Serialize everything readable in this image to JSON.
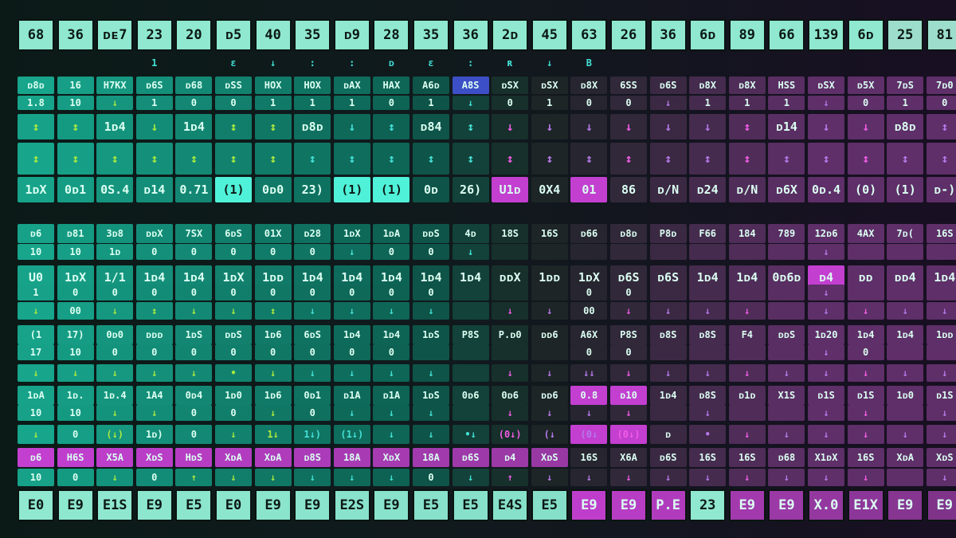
{
  "colors": {
    "light": "#8fe8cf",
    "teal": "#17a58c",
    "teal_dark": "#0c5a4d",
    "dark": "#1a2422",
    "magenta": "#c33fd0",
    "purple": "#5e2f68",
    "blue": "#3d4fc6",
    "text_dark": "#0c1814",
    "text_light": "#dcfff2",
    "arrow_green": "#a9ea3f",
    "arrow_cyan": "#44e1d6",
    "arrow_pink": "#f25ce6",
    "arrow_purple": "#b67aea"
  },
  "header_row": [
    "68",
    "36",
    "ᴅᴇ7",
    "23",
    "20",
    "ᴅ5",
    "40",
    "35",
    "ᴅ9",
    "28",
    "35",
    "36",
    "2ᴅ",
    "45",
    "63",
    "26",
    "36",
    "6ᴅ",
    "89",
    "66",
    "139",
    "6ᴅ",
    "25",
    "81"
  ],
  "footer_row": [
    "E0",
    "E9",
    "E1S",
    "E9",
    "E5",
    "E0",
    "E9",
    "E9",
    "E2S",
    "E9",
    "E5",
    "E5",
    "E4S",
    "E5",
    "E9",
    "E9",
    "P.E",
    "23",
    "E9",
    "E9",
    "X.0",
    "E1X",
    "E9",
    "E9"
  ],
  "sparse_header_marks": [
    "1",
    "ɛ",
    "↓",
    ":",
    ":",
    "ᴅ",
    "ɛ",
    ":",
    "ʀ",
    "↓",
    "B"
  ],
  "grid_rows": [
    {
      "labels": [
        "ᴅ8ᴅ",
        "16",
        "H7KX",
        "ᴅ6S",
        "ᴅ68",
        "ᴅSS",
        "HOX",
        "HOX",
        "ᴅAX",
        "HAX",
        "A6ᴅ",
        "A8S",
        "ᴅSX",
        "ᴅSX",
        "ᴅ8X",
        "6SS",
        "ᴅ6S",
        "ᴅ8X",
        "ᴅ8X",
        "HSS",
        "ᴅSX",
        "ᴅ5X",
        "7ᴅS",
        "7ᴅ0"
      ]
    },
    {
      "labels": [
        "1.8",
        "10",
        "↓",
        "1",
        "0",
        "0",
        "1",
        "1",
        "1",
        "0",
        "1",
        "↓",
        "0",
        "1",
        "0",
        "0",
        "↓",
        "1",
        "1",
        "1",
        "↓",
        "0",
        "1",
        "0"
      ]
    },
    {
      "labels": [
        "↕",
        "↕",
        "1ᴅ4",
        "↓",
        "1ᴅ4",
        "↕",
        "↕",
        "ᴅ8ᴅ",
        "↓",
        "↕",
        "ᴅ84",
        "↕",
        "↓",
        "↓",
        "↓",
        "↓",
        "↓",
        "↓",
        "↕",
        "ᴅ14",
        "↓",
        "↓",
        "ᴅ8ᴅ",
        "↕"
      ]
    },
    {
      "labels": [
        "↕",
        "↕",
        "↕",
        "↕",
        "↕",
        "↕",
        "↕",
        "↕",
        "↕",
        "↕",
        "↕",
        "↕",
        "↕",
        "↕",
        "↕",
        "↕",
        "↕",
        "↕",
        "↕",
        "↕",
        "↕",
        "↕",
        "↕",
        "↕"
      ]
    },
    {
      "labels": [
        "1ᴅX",
        "0ᴅ1",
        "0S.4",
        "ᴅ14",
        "0.71",
        "(1)",
        "0ᴅ0",
        "23)",
        "(1)",
        "(1)",
        "0ᴅ",
        "26)",
        "U1ᴅ",
        "0X4",
        "01",
        "86",
        "ᴅ/N",
        "ᴅ24",
        "ᴅ/N",
        "ᴅ6X",
        "0ᴅ.4",
        "(0)",
        "(1)",
        "ᴅ-)"
      ]
    },
    {
      "labels": [
        "ᴅ6",
        "ᴅ81",
        "3ᴅ8",
        "ᴅᴅX",
        "7SX",
        "6ᴅS",
        "01X",
        "ᴅ28",
        "1ᴅX",
        "1ᴅA",
        "ᴅᴅS",
        "4ᴅ",
        "18S",
        "16S",
        "ᴅ66",
        "ᴅ8ᴅ",
        "P8ᴅ",
        "F66",
        "184",
        "789",
        "12ᴅ6",
        "4AX",
        "7ᴅ(",
        "16S"
      ]
    },
    {
      "labels": [
        "10",
        "10",
        "1ᴅ",
        "0",
        "0",
        "0",
        "0",
        "0",
        "↓",
        "0",
        "0",
        "↓",
        "",
        "",
        "",
        "",
        "",
        "",
        "",
        "",
        "↓",
        "",
        "",
        ""
      ]
    },
    {
      "labels": [
        "U0",
        "1ᴅX",
        "1/1",
        "1ᴅ4",
        "1ᴅ4",
        "1ᴅX",
        "1ᴅᴅ",
        "1ᴅ4",
        "1ᴅ4",
        "1ᴅ4",
        "1ᴅ4",
        "1ᴅ4",
        "ᴅᴅX",
        "1ᴅᴅ",
        "1ᴅX",
        "ᴅ6S",
        "ᴅ6S",
        "1ᴅ4",
        "1ᴅ4",
        "0ᴅ6ᴅ",
        "ᴅ4",
        "ᴅᴅ",
        "ᴅᴅ4",
        "1ᴅ4"
      ]
    },
    {
      "labels": [
        "1",
        "0",
        "0",
        "0",
        "0",
        "0",
        "0",
        "0",
        "0",
        "0",
        "0",
        "",
        "",
        "",
        "0",
        "0",
        "",
        "",
        "",
        "",
        "↓",
        "",
        "",
        ""
      ]
    },
    {
      "labels": [
        "↓",
        "00",
        "↓",
        "↕",
        "↓",
        "↓",
        "↕",
        "↓",
        "↓",
        "↓",
        "↓",
        "",
        "↓",
        "↓",
        "00",
        "↓",
        "↓",
        "↓",
        "↓",
        "",
        "↓",
        "↓",
        "↓",
        "↓"
      ]
    },
    {
      "labels": [
        "(1",
        "17)",
        "0ᴅ0",
        "ᴅᴅᴅ",
        "1ᴅS",
        "ᴅᴅS",
        "1ᴅ6",
        "6ᴅS",
        "1ᴅ4",
        "1ᴅ4",
        "1ᴅS",
        "P8S",
        "P.ᴅ0",
        "ᴅᴅ6",
        "A6X",
        "P8S",
        "ᴅ8S",
        "ᴅ8S",
        "F4",
        "ᴅᴅS",
        "1ᴅ20",
        "1ᴅ4",
        "1ᴅ4",
        "1ᴅᴅ"
      ]
    },
    {
      "labels": [
        "17",
        "10",
        "0",
        "0",
        "0",
        "0",
        "0",
        "0",
        "0",
        "0",
        "",
        "",
        "",
        "",
        "0",
        "0",
        "",
        "",
        "",
        "",
        "↓",
        "0",
        "",
        ""
      ]
    },
    {
      "labels": [
        "↓",
        "↓",
        "↓",
        "↓",
        "↓",
        "•",
        "↓",
        "↓",
        "↓",
        "↓",
        "↓",
        "",
        "↓",
        "↓",
        "↓↓",
        "↓",
        "↓",
        "↓",
        "↓",
        "↓",
        "↓",
        "↓",
        "↓",
        "↓"
      ]
    },
    {
      "labels": [
        "1ᴅA",
        "1ᴅ.",
        "1ᴅ.4",
        "1A4",
        "0ᴅ4",
        "1ᴅ0",
        "1ᴅ6",
        "0ᴅ1",
        "ᴅ1A",
        "ᴅ1A",
        "1ᴅS",
        "0ᴅ6",
        "0ᴅ6",
        "ᴅᴅ6",
        "0.8",
        "ᴅ10",
        "1ᴅ4",
        "ᴅ8S",
        "ᴅ1ᴅ",
        "X1S",
        "ᴅ1S",
        "ᴅ1S",
        "1ᴅ0",
        "ᴅ1S"
      ]
    },
    {
      "labels": [
        "10",
        "10",
        "↓",
        "↓",
        "0",
        "0",
        "↓",
        "0",
        "↓",
        "↓",
        "↓",
        "",
        "↓",
        "↓",
        "↓",
        "↓",
        "",
        "↓",
        "",
        "",
        "↓",
        "↓",
        "",
        "↓"
      ]
    },
    {
      "labels": [
        "↓",
        "0",
        "(↓)",
        "1ᴅ)",
        "0",
        "↓",
        "1↓",
        "1↓)",
        "(1↓)",
        "↓",
        "↓",
        "•↓",
        "(0↓)",
        "(↓",
        "(0↓",
        "(0↓)",
        "ᴅ",
        "•",
        "↓",
        "↓",
        "↓",
        "↓",
        "↓",
        "↓"
      ]
    },
    {
      "labels": [
        "ᴅ6",
        "H6S",
        "X5A",
        "XᴅS",
        "HᴅS",
        "XᴅA",
        "XᴅA",
        "ᴅ8S",
        "18A",
        "XᴅX",
        "18A",
        "ᴅ6S",
        "ᴅ4",
        "XᴅS",
        "16S",
        "X6A",
        "ᴅ6S",
        "16S",
        "16S",
        "ᴅ68",
        "X1ᴅX",
        "16S",
        "XᴅA",
        "XᴅS"
      ]
    },
    {
      "labels": [
        "10",
        "0",
        "↓",
        "0",
        "↑",
        "↓",
        "↓",
        "↓",
        "↓",
        "↓",
        "0",
        "↓",
        "↑",
        "↓",
        "↓",
        "↓",
        "↓",
        "↓",
        "↓",
        "↓",
        "↓",
        "↓",
        "",
        "↓"
      ]
    }
  ]
}
